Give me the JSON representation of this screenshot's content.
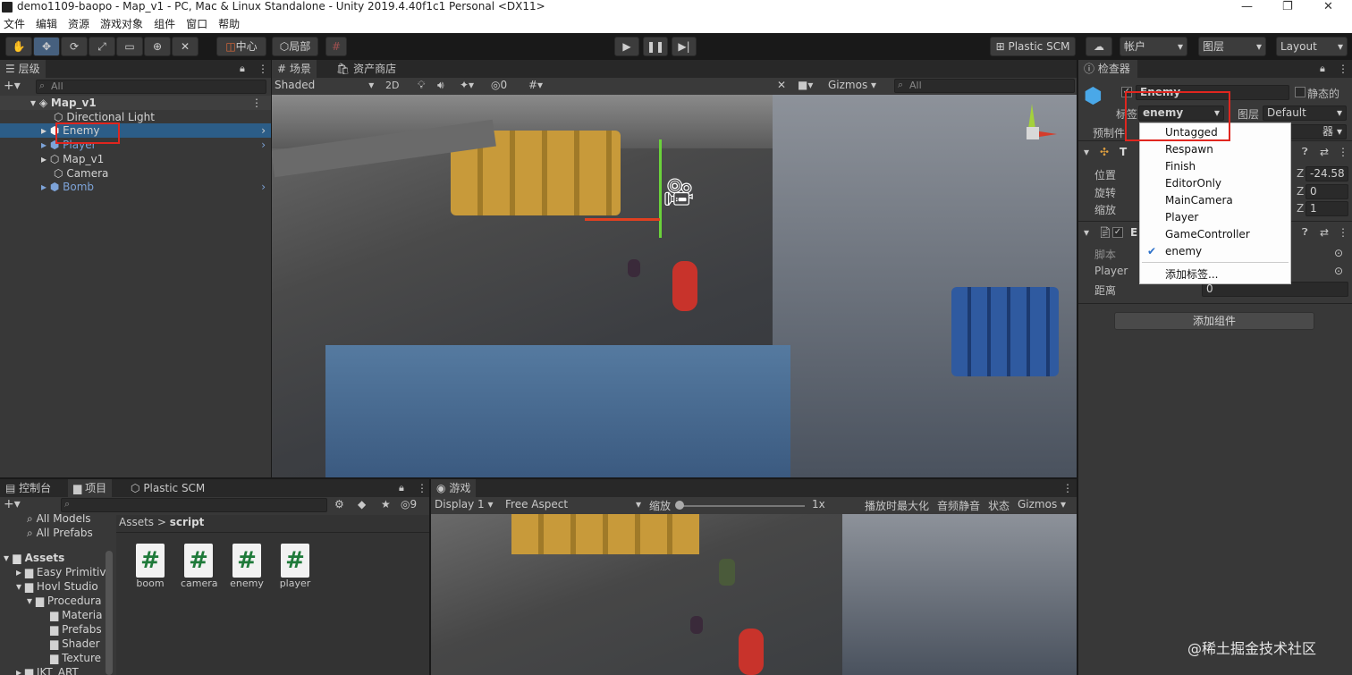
{
  "window": {
    "title": "demo1109-baopo - Map_v1 - PC, Mac & Linux Standalone - Unity 2019.4.40f1c1 Personal <DX11>"
  },
  "menu": [
    "文件",
    "编辑",
    "资源",
    "游戏对象",
    "组件",
    "窗口",
    "帮助"
  ],
  "toolbar": {
    "pivot": "中心",
    "space": "局部",
    "plastic": "Plastic SCM",
    "account": "帐户",
    "layers": "图层",
    "layout": "Layout"
  },
  "hierarchy": {
    "tab": "层级",
    "search_placeholder": "All",
    "scene": "Map_v1",
    "items": [
      "Directional Light",
      "Enemy",
      "Player",
      "Map_v1",
      "Camera",
      "Bomb"
    ]
  },
  "scene": {
    "tab_scene": "场景",
    "tab_store": "资产商店",
    "shading": "Shaded",
    "mode2d": "2D",
    "hidden_count": "0",
    "gizmos": "Gizmos",
    "search_placeholder": "All"
  },
  "inspector": {
    "tab": "检查器",
    "object_name": "Enemy",
    "static": "静态的",
    "tag_label": "标签",
    "tag_value": "enemy",
    "layer_label": "图层",
    "layer_value": "Default",
    "prefab_label": "预制件",
    "transform_short": "T",
    "position_label": "位置",
    "rotation_label": "旋转",
    "scale_label": "缩放",
    "pos_z": "-24.58",
    "rot_z": "0",
    "scale_z": "1",
    "script_comp_short": "E",
    "script_label": "脚本",
    "player_label": "Player",
    "distance_label": "距离",
    "distance_value": "0",
    "add_component": "添加组件",
    "z": "Z",
    "layer_suffix": "器"
  },
  "tag_dropdown": {
    "options": [
      "Untagged",
      "Respawn",
      "Finish",
      "EditorOnly",
      "MainCamera",
      "Player",
      "GameController",
      "enemy"
    ],
    "selected": "enemy",
    "add_tag": "添加标签..."
  },
  "project": {
    "tab_console": "控制台",
    "tab_project": "项目",
    "tab_plastic": "Plastic SCM",
    "hidden_count": "9",
    "fav_models": "All Models",
    "fav_prefabs": "All Prefabs",
    "breadcrumb_root": "Assets",
    "breadcrumb_sep": ">",
    "breadcrumb_current": "script",
    "tree": [
      "Assets",
      "Easy Primitiv",
      "Hovl Studio",
      "Procedura",
      "Materia",
      "Prefabs",
      "Shader",
      "Texture",
      "JKT_ART"
    ],
    "assets": [
      "boom",
      "camera",
      "enemy",
      "player"
    ]
  },
  "game": {
    "tab": "游戏",
    "display": "Display 1",
    "aspect": "Free Aspect",
    "scale_label": "缩放",
    "scale_value": "1x",
    "maximize": "播放时最大化",
    "mute": "音频静音",
    "stats": "状态",
    "gizmos": "Gizmos"
  },
  "watermark": "@稀土掘金技术社区"
}
